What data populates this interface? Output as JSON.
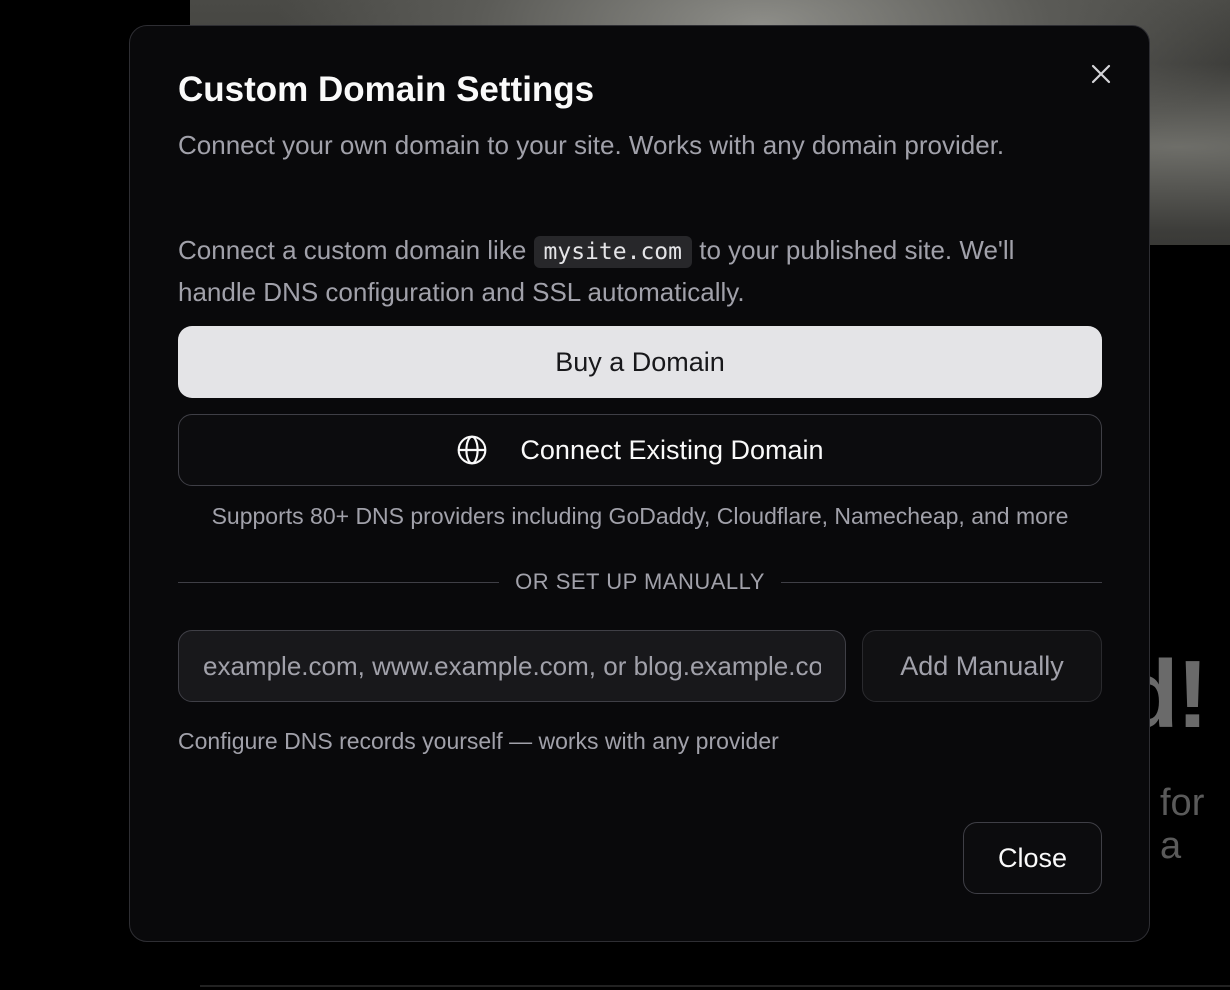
{
  "background": {
    "heading_fragment": "d!",
    "subtext_fragment": "for a"
  },
  "modal": {
    "title": "Custom Domain Settings",
    "subtitle": "Connect your own domain to your site. Works with any domain provider.",
    "intro_before": "Connect a custom domain like ",
    "intro_code": "mysite.com",
    "intro_after": " to your published site. We'll handle DNS configuration and SSL automatically.",
    "buy_label": "Buy a Domain",
    "connect_label": "Connect Existing Domain",
    "connect_icon": "globe-icon",
    "supports_text": "Supports 80+ DNS providers including GoDaddy, Cloudflare, Namecheap, and more",
    "divider_label": "OR SET UP MANUALLY",
    "domain_input": {
      "value": "",
      "placeholder": "example.com, www.example.com, or blog.example.com"
    },
    "add_manually_label": "Add Manually",
    "hint_text": "Configure DNS records yourself — works with any provider",
    "close_label": "Close",
    "close_icon": "close-icon"
  },
  "colors": {
    "overlay": "#000000",
    "modal_bg": "#09090b",
    "primary_button_bg": "#e4e4e7",
    "muted_text": "#a1a1aa",
    "border": "#3f3f46"
  }
}
